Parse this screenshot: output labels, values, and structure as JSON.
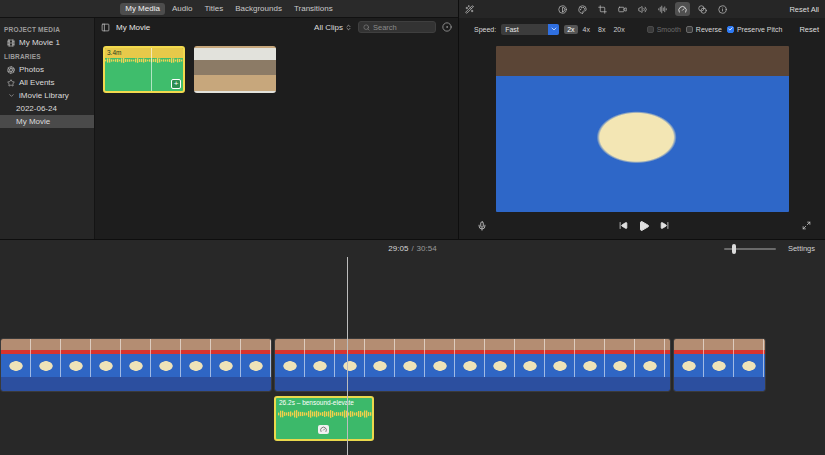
{
  "media_tabs": [
    {
      "label": "My Media",
      "selected": true
    },
    {
      "label": "Audio",
      "selected": false
    },
    {
      "label": "Titles",
      "selected": false
    },
    {
      "label": "Backgrounds",
      "selected": false
    },
    {
      "label": "Transitions",
      "selected": false
    }
  ],
  "sidebar": {
    "sections": [
      {
        "header": "PROJECT MEDIA",
        "items": [
          {
            "label": "My Movie 1",
            "selected": false
          }
        ]
      },
      {
        "header": "LIBRARIES",
        "items": [
          {
            "label": "Photos",
            "selected": false
          },
          {
            "label": "All Events",
            "selected": false
          },
          {
            "label": "iMovie Library",
            "selected": false,
            "expanded": true,
            "children": [
              {
                "label": "2022-06-24",
                "selected": false
              },
              {
                "label": "My Movie",
                "selected": true
              }
            ]
          }
        ]
      }
    ]
  },
  "browser": {
    "title": "My Movie",
    "filter": "All Clips",
    "search": {
      "placeholder": "Search"
    },
    "clips": [
      {
        "kind": "audio",
        "label": "3.4m",
        "badge": "+",
        "selected": true
      },
      {
        "kind": "video",
        "selected": false
      }
    ]
  },
  "viewer": {
    "reset_all": "Reset All",
    "tools": [
      {
        "selected": false
      },
      {
        "selected": false
      },
      {
        "selected": false
      },
      {
        "selected": false
      },
      {
        "selected": false
      },
      {
        "selected": false
      },
      {
        "selected": true
      },
      {
        "selected": false
      },
      {
        "selected": false
      }
    ],
    "speed": {
      "label": "Speed:",
      "value": "Fast",
      "rates": [
        {
          "label": "2x",
          "selected": true
        },
        {
          "label": "4x",
          "selected": false
        },
        {
          "label": "8x",
          "selected": false
        },
        {
          "label": "20x",
          "selected": false
        }
      ],
      "options": [
        {
          "label": "Smooth",
          "checked": false,
          "disabled": true
        },
        {
          "label": "Reverse",
          "checked": false,
          "disabled": false
        },
        {
          "label": "Preserve Pitch",
          "checked": true,
          "disabled": false
        }
      ],
      "reset": "Reset"
    }
  },
  "timeline": {
    "timecode": {
      "current": "29:05",
      "separator": "/",
      "total": "30:54"
    },
    "zoom": {
      "level": 0.2
    },
    "settings": "Settings",
    "playhead": {
      "level": 0.42
    },
    "video_clips": [
      {
        "selected": false
      },
      {
        "selected": false
      },
      {
        "selected": false
      }
    ],
    "audio_clip": {
      "label": "26.2s – bensound-elevate",
      "selected": true
    }
  }
}
